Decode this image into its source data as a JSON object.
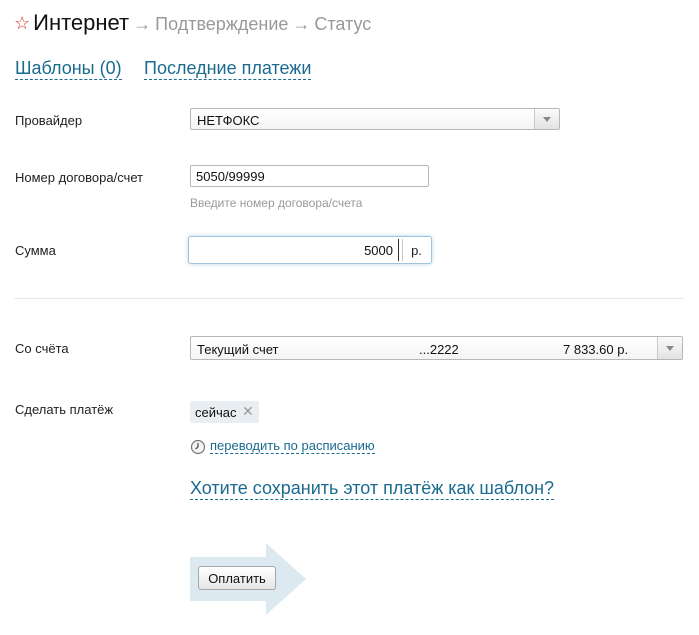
{
  "header": {
    "star_icon": "star-outline-icon",
    "title": "Интернет",
    "arrow": "→",
    "steps": [
      "Подтверждение",
      "Статус"
    ]
  },
  "tabs": [
    {
      "label": "Шаблоны (0)"
    },
    {
      "label": "Последние платежи"
    }
  ],
  "form": {
    "provider": {
      "label": "Провайдер",
      "value": "НЕТФОКС"
    },
    "contract": {
      "label": "Номер договора/счет",
      "value": "5050/99999",
      "hint": "Введите номер договора/счета"
    },
    "amount": {
      "label": "Сумма",
      "value": "5000",
      "currency": "р."
    },
    "account": {
      "label": "Со счёта",
      "name": "Текущий счет",
      "number": "...2222",
      "balance": "7 833.60 р."
    },
    "when": {
      "label": "Сделать платёж",
      "tag": "сейчас",
      "schedule_link": "переводить по расписанию"
    },
    "save_template_link": "Хотите сохранить этот платёж как шаблон?",
    "pay_button": "Оплатить"
  },
  "colors": {
    "accent_link": "#1a6b8f",
    "star": "#d43a2a",
    "focus": "#7fb3d3",
    "arrow_shape": "#dce9f1"
  }
}
